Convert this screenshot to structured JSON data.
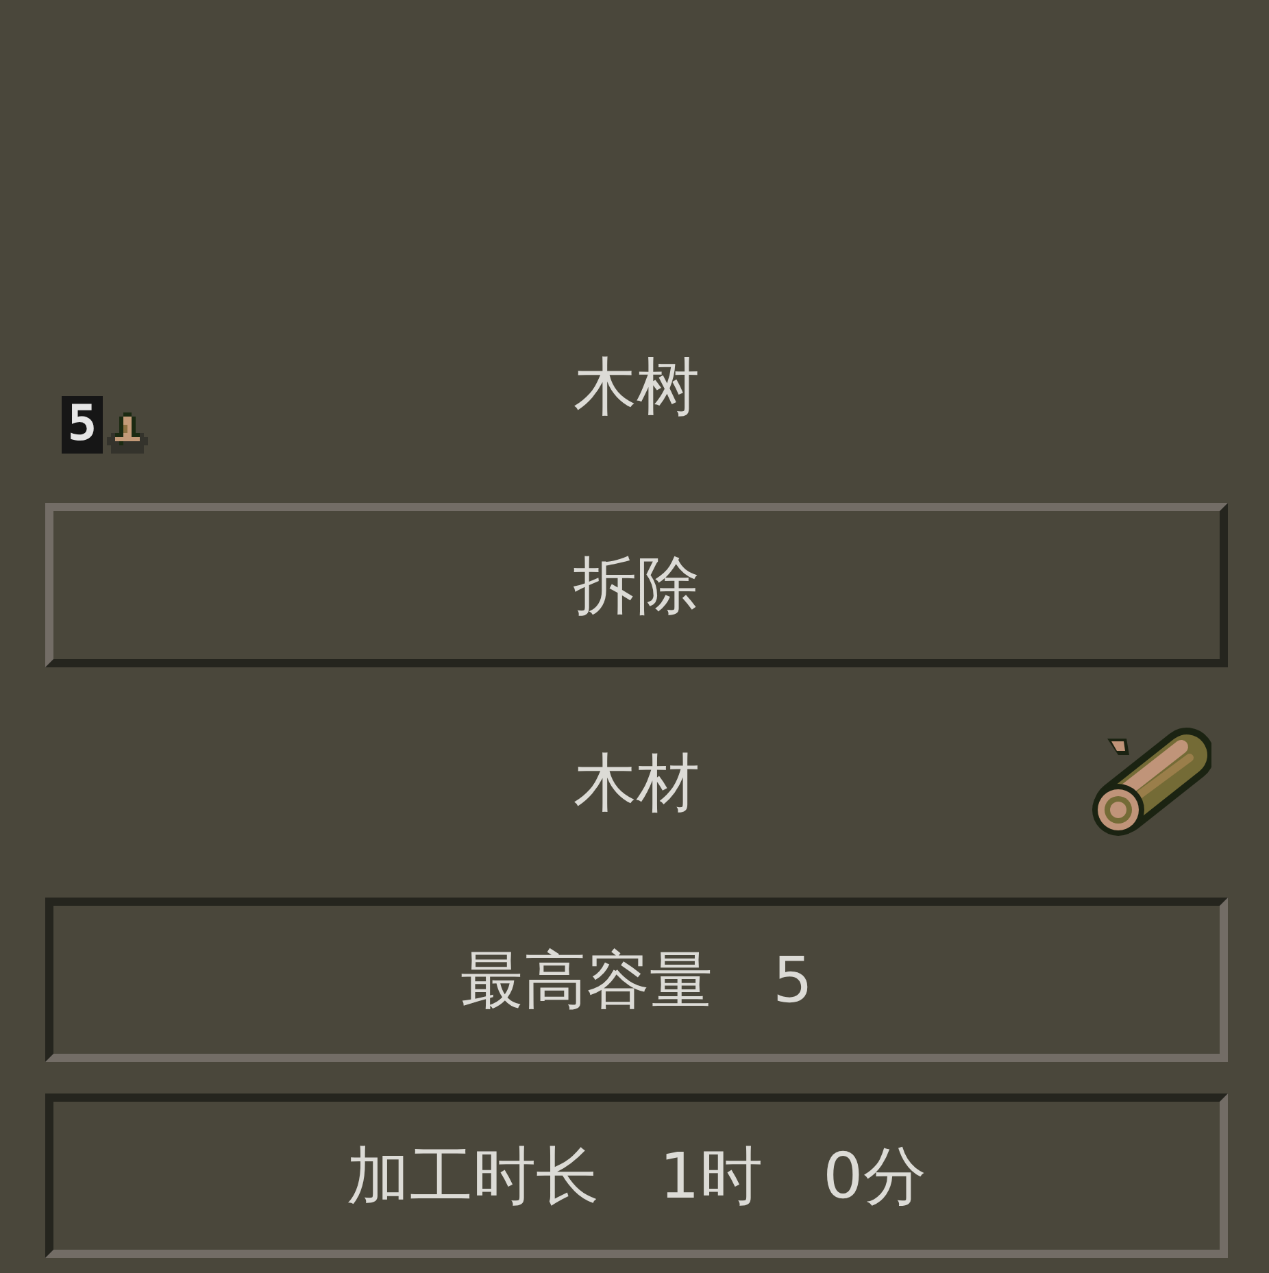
{
  "header": {
    "title": "木树",
    "count": "5"
  },
  "actions": [
    {
      "label": "拆除"
    }
  ],
  "product": {
    "name": "木材"
  },
  "stats": [
    {
      "label": "最高容量",
      "values": [
        "5"
      ]
    },
    {
      "label": "加工时长",
      "values": [
        "1时",
        "0分"
      ]
    }
  ]
}
